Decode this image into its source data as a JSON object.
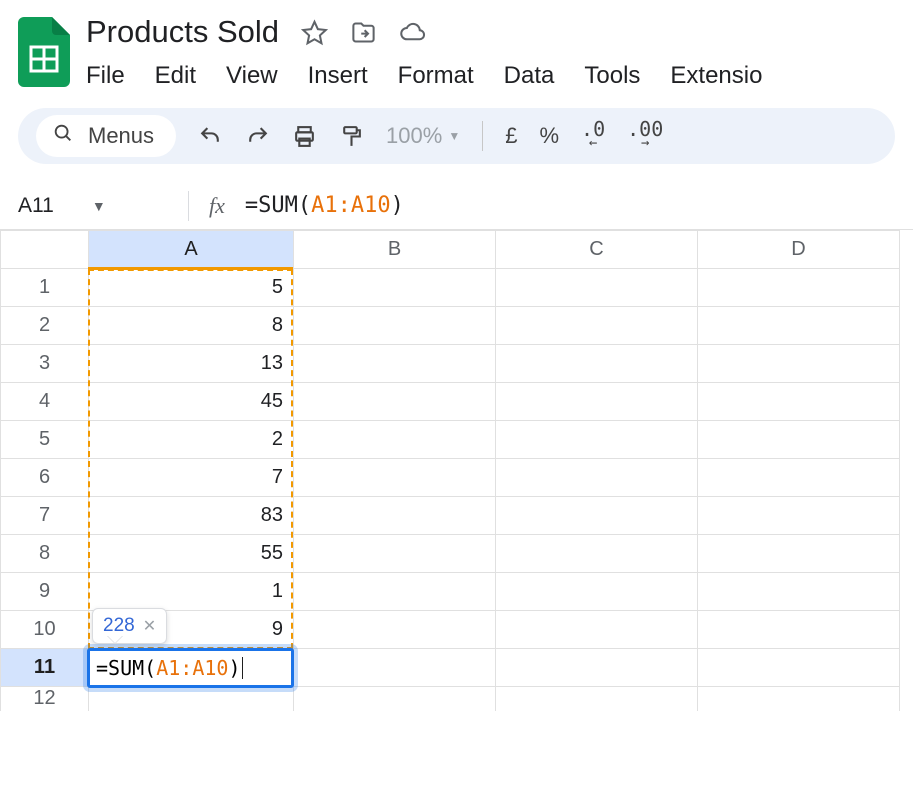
{
  "doc_title": "Products Sold",
  "menubar": [
    "File",
    "Edit",
    "View",
    "Insert",
    "Format",
    "Data",
    "Tools",
    "Extensio"
  ],
  "toolbar": {
    "menus_label": "Menus",
    "zoom": "100%",
    "currency_symbol": "£",
    "percent_symbol": "%",
    "dec_decrease": ".0",
    "dec_increase": ".00"
  },
  "namebox": "A11",
  "formula_bar": {
    "prefix": "=SUM(",
    "ref": "A1:A10",
    "suffix": ")"
  },
  "columns": [
    "A",
    "B",
    "C",
    "D"
  ],
  "selected_column": "A",
  "rows": [
    {
      "n": "1",
      "A": "5"
    },
    {
      "n": "2",
      "A": "8"
    },
    {
      "n": "3",
      "A": "13"
    },
    {
      "n": "4",
      "A": "45"
    },
    {
      "n": "5",
      "A": "2"
    },
    {
      "n": "6",
      "A": "7"
    },
    {
      "n": "7",
      "A": "83"
    },
    {
      "n": "8",
      "A": "55"
    },
    {
      "n": "9",
      "A": "1"
    },
    {
      "n": "10",
      "A": "9"
    },
    {
      "n": "11",
      "A": ""
    },
    {
      "n": "12",
      "A": ""
    }
  ],
  "active_row": "11",
  "editing_cell": {
    "prefix": "=SUM(",
    "ref": "A1:A10",
    "suffix": ")"
  },
  "tooltip_value": "228"
}
